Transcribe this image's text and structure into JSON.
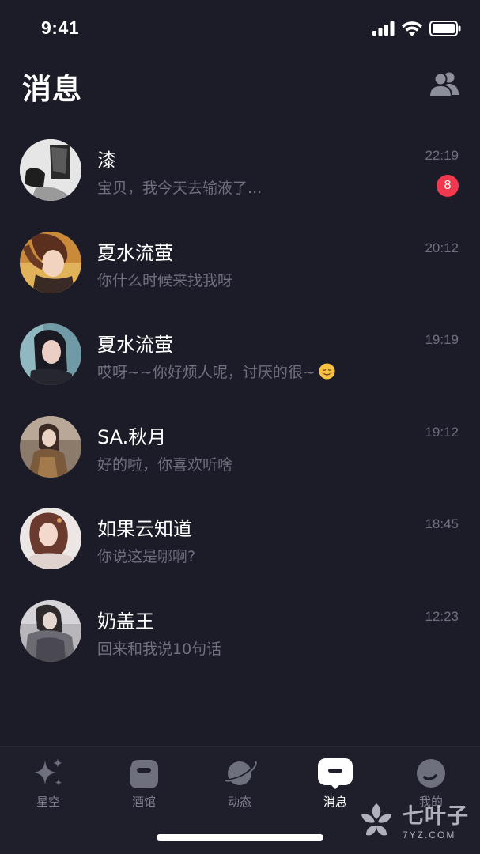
{
  "status_bar": {
    "time": "9:41"
  },
  "header": {
    "title": "消息",
    "contacts_icon": "contacts-icon"
  },
  "conversations": [
    {
      "name": "漆",
      "preview": "宝贝，我今天去输液了...",
      "time": "22:19",
      "unread": "8"
    },
    {
      "name": "夏水流萤",
      "preview": "你什么时候来找我呀",
      "time": "20:12"
    },
    {
      "name": "夏水流萤",
      "preview": "哎呀~~你好烦人呢，讨厌的很~",
      "time": "19:19",
      "emoji": "relieved-face-emoji"
    },
    {
      "name": "SA.秋月",
      "preview": "好的啦，你喜欢听啥",
      "time": "19:12"
    },
    {
      "name": "如果云知道",
      "preview": "你说这是哪啊?",
      "time": "18:45"
    },
    {
      "name": "奶盖王",
      "preview": "回来和我说10句话",
      "time": "12:23"
    }
  ],
  "tabs": [
    {
      "label": "星空",
      "icon": "sparkle-icon"
    },
    {
      "label": "酒馆",
      "icon": "tavern-icon"
    },
    {
      "label": "动态",
      "icon": "planet-icon"
    },
    {
      "label": "消息",
      "icon": "message-icon",
      "active": true
    },
    {
      "label": "我的",
      "icon": "profile-icon"
    }
  ],
  "watermark": {
    "cn": "七叶子",
    "en": "7YZ.COM"
  },
  "colors": {
    "background": "#1b1c27",
    "badge": "#f0394e",
    "secondary_text": "#6e7080"
  }
}
